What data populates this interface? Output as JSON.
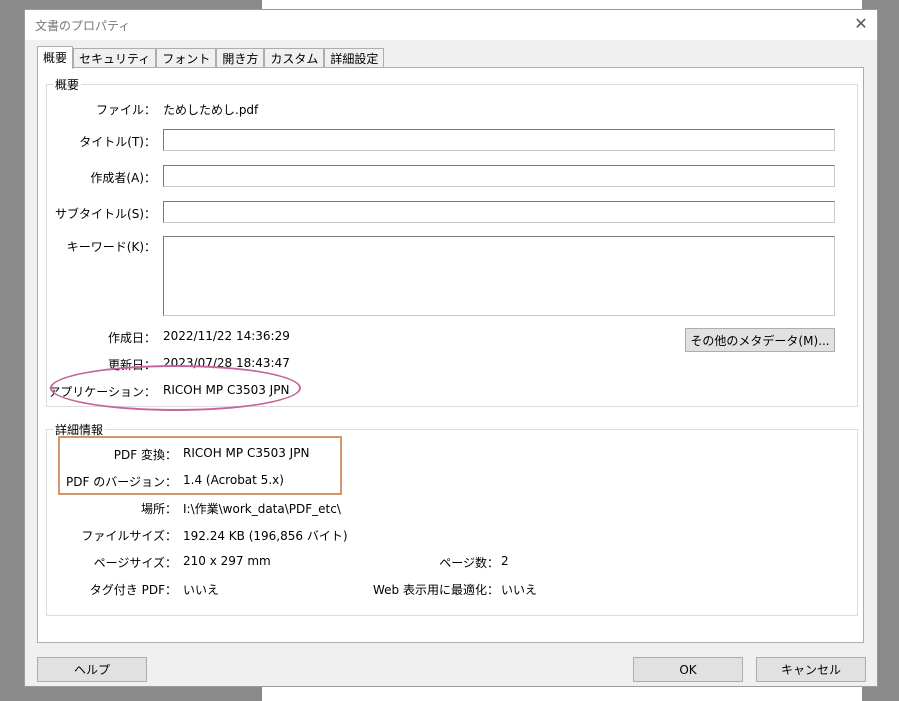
{
  "dialog": {
    "title": "文書のプロパティ",
    "close": "✕"
  },
  "tabs": [
    "概要",
    "セキュリティ",
    "フォント",
    "開き方",
    "カスタム",
    "詳細設定"
  ],
  "summary": {
    "legend": "概要",
    "file_label": "ファイル：",
    "file_value": "ためしためし.pdf",
    "title_label": "タイトル(T)：",
    "title_value": "",
    "author_label": "作成者(A)：",
    "author_value": "",
    "subject_label": "サブタイトル(S)：",
    "subject_value": "",
    "keywords_label": "キーワード(K)：",
    "keywords_value": "",
    "created_label": "作成日：",
    "created_value": "2022/11/22 14:36:29",
    "modified_label": "更新日：",
    "modified_value": "2023/07/28 18:43:47",
    "app_label": "アプリケーション：",
    "app_value": "RICOH MP C3503 JPN",
    "metadata_button": "その他のメタデータ(M)..."
  },
  "details": {
    "legend": "詳細情報",
    "producer_label": "PDF 変換：",
    "producer_value": "RICOH MP C3503 JPN",
    "version_label": "PDF のバージョン：",
    "version_value": "1.4 (Acrobat 5.x)",
    "location_label": "場所：",
    "location_value": "I:\\作業\\work_data\\PDF_etc\\",
    "filesize_label": "ファイルサイズ：",
    "filesize_value": "192.24 KB (196,856 バイト)",
    "pagesize_label": "ページサイズ：",
    "pagesize_value": "210 x 297 mm",
    "pages_label": "ページ数：",
    "pages_value": "2",
    "tagged_label": "タグ付き PDF：",
    "tagged_value": "いいえ",
    "fastweb_label": "Web 表示用に最適化：",
    "fastweb_value": "いいえ"
  },
  "buttons": {
    "help": "ヘルプ",
    "ok": "OK",
    "cancel": "キャンセル"
  },
  "annotations": {
    "ellipse_color": "#c4669a",
    "rect_color": "#d4956a"
  }
}
